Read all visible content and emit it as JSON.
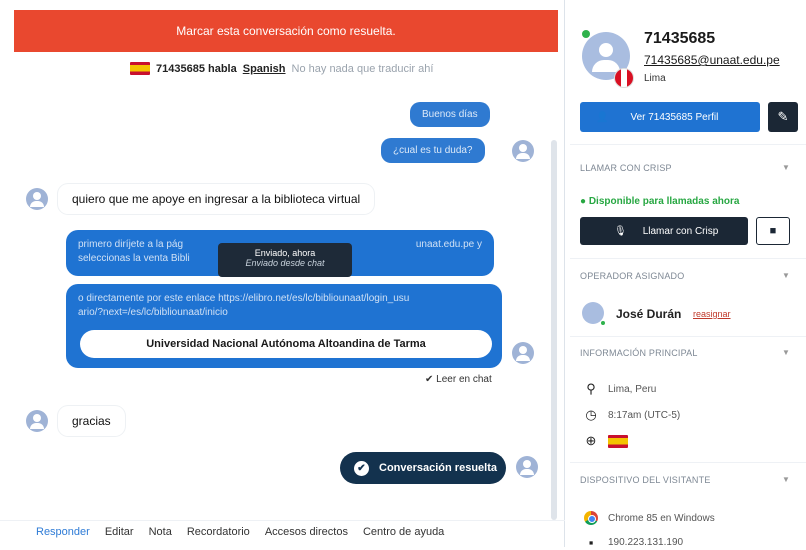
{
  "chat": {
    "resolve_bar": "Marcar esta conversación como resuelta.",
    "translate": {
      "user": "71435685 habla",
      "language": "Spanish",
      "note": "No hay nada que traducir ahí"
    },
    "messages": {
      "m1": "Buenos días",
      "m2": "¿cual es tu duda?",
      "m3": "quiero que me apoye en ingresar a la biblioteca virtual",
      "m4_line1": "primero diríjete a la pág",
      "m4_line1b": "unaat.edu.pe y",
      "m4_line2": "seleccionas la venta Bibli",
      "m5_line1": "o directamente por este enlace https://elibro.net/es/lc/bibliounaat/login_usu",
      "m5_line2": "ario/?next=/es/lc/bibliounaat/inicio",
      "link_title": "Universidad Nacional Autónoma Altoandina de Tarma",
      "m6": "gracias"
    },
    "tooltip": {
      "title": "Enviado, ahora",
      "subtitle": "Enviado desde chat"
    },
    "read_label": "✔ Leer en chat",
    "resolved_label": "Conversación resuelta",
    "toolbar": [
      "Responder",
      "Editar",
      "Nota",
      "Recordatorio",
      "Accesos directos",
      "Centro de ayuda"
    ]
  },
  "sidebar": {
    "name": "71435685",
    "email": "71435685@unaat.edu.pe",
    "city": "Lima",
    "profile_button": "Ver 71435685 Perfil",
    "call_section": "LLAMAR CON CRISP",
    "availability": "● Disponible para llamadas ahora",
    "call_button": "Llamar con Crisp",
    "operator_section": "OPERADOR ASIGNADO",
    "operator_name": "José Durán",
    "reassign": "reasignar",
    "info_section": "INFORMACIÓN PRINCIPAL",
    "location": "Lima, Peru",
    "time": "8:17am (UTC-5)",
    "device_section": "DISPOSITIVO DEL VISITANTE",
    "browser": "Chrome 85 en Windows",
    "ip": "190.223.131.190"
  },
  "icons": {
    "edit": "pencil-icon",
    "call": "microphone-icon",
    "video": "video-icon",
    "location": "pin-icon",
    "time": "clock-icon",
    "globe": "globe-icon"
  },
  "colors": {
    "resolve_red": "#e9482f",
    "primary_blue": "#1f73d2",
    "dark_navy": "#1b2735",
    "available_green": "#27a742"
  }
}
